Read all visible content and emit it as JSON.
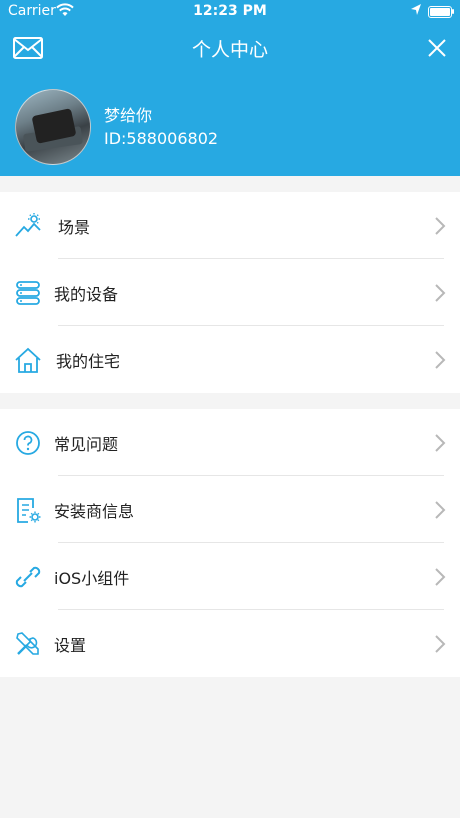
{
  "status_bar": {
    "carrier": "Carrier",
    "time": "12:23 PM"
  },
  "nav": {
    "title": "个人中心"
  },
  "profile": {
    "name": "梦给你",
    "id": "ID:588006802"
  },
  "menu_group_1": [
    {
      "label": "场景",
      "icon": "scene-icon"
    },
    {
      "label": "我的设备",
      "icon": "devices-icon"
    },
    {
      "label": "我的住宅",
      "icon": "home-icon"
    }
  ],
  "menu_group_2": [
    {
      "label": "常见问题",
      "icon": "question-icon"
    },
    {
      "label": "安装商信息",
      "icon": "installer-info-icon"
    },
    {
      "label": "iOS小组件",
      "icon": "link-icon"
    },
    {
      "label": "设置",
      "icon": "tools-icon"
    }
  ],
  "colors": {
    "accent": "#27a9e2",
    "background": "#f4f4f4",
    "divider": "#e6e6e6",
    "chevron": "#b8b8b8"
  }
}
